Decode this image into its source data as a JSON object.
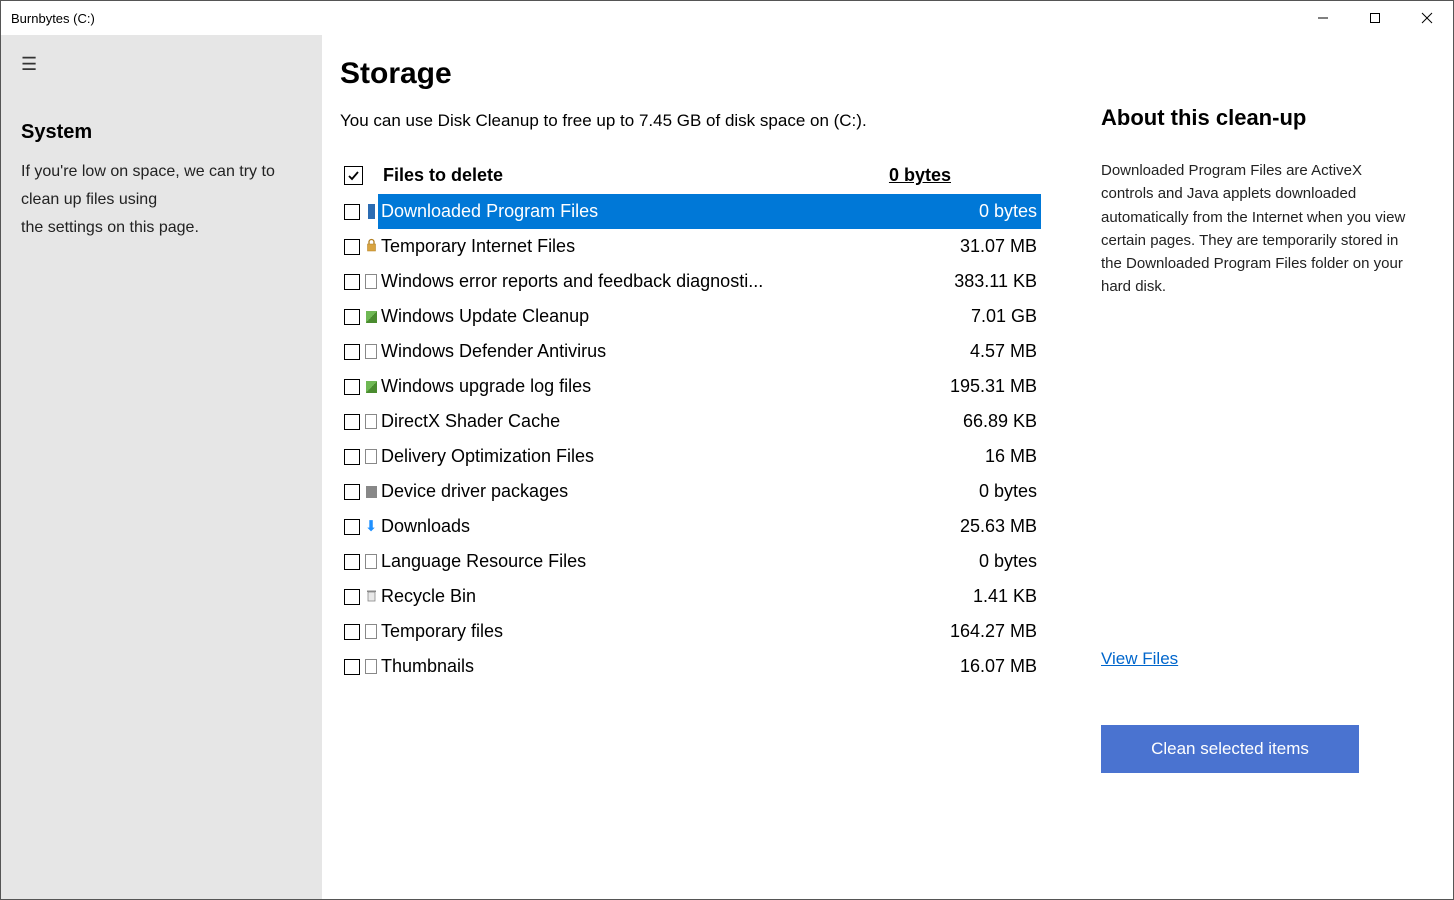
{
  "window": {
    "title": "Burnbytes (C:)"
  },
  "sidebar": {
    "heading": "System",
    "description": "If you're low on space, we can try to clean up files using\nthe settings on this page."
  },
  "center": {
    "heading": "Storage",
    "subtitle": "You can use Disk Cleanup to free up to 7.45 GB of disk space on  (C:).",
    "header_label": "Files to delete",
    "header_size": "0 bytes",
    "header_checked": true,
    "items": [
      {
        "name": "Downloaded Program Files",
        "size": "0 bytes",
        "icon": "blue-bar",
        "selected": true
      },
      {
        "name": "Temporary Internet Files",
        "size": "31.07 MB",
        "icon": "lock"
      },
      {
        "name": "Windows error reports and feedback diagnosti...",
        "size": "383.11 KB",
        "icon": "page"
      },
      {
        "name": "Windows Update Cleanup",
        "size": "7.01 GB",
        "icon": "chip"
      },
      {
        "name": "Windows Defender Antivirus",
        "size": "4.57 MB",
        "icon": "page"
      },
      {
        "name": "Windows upgrade log files",
        "size": "195.31 MB",
        "icon": "chip"
      },
      {
        "name": "DirectX Shader Cache",
        "size": "66.89 KB",
        "icon": "page"
      },
      {
        "name": "Delivery Optimization Files",
        "size": "16 MB",
        "icon": "page"
      },
      {
        "name": "Device driver packages",
        "size": "0 bytes",
        "icon": "box"
      },
      {
        "name": "Downloads",
        "size": "25.63 MB",
        "icon": "arrow"
      },
      {
        "name": "Language Resource Files",
        "size": "0 bytes",
        "icon": "page"
      },
      {
        "name": "Recycle Bin",
        "size": "1.41 KB",
        "icon": "bin"
      },
      {
        "name": "Temporary files",
        "size": "164.27 MB",
        "icon": "page"
      },
      {
        "name": "Thumbnails",
        "size": "16.07 MB",
        "icon": "page"
      }
    ]
  },
  "right": {
    "heading": "About this clean-up",
    "body": "Downloaded Program Files are ActiveX controls and Java applets downloaded automatically from the Internet when you view certain pages. They are temporarily stored in the Downloaded Program Files folder on your hard disk.",
    "view_link": "View Files",
    "clean_button": "Clean selected items"
  }
}
